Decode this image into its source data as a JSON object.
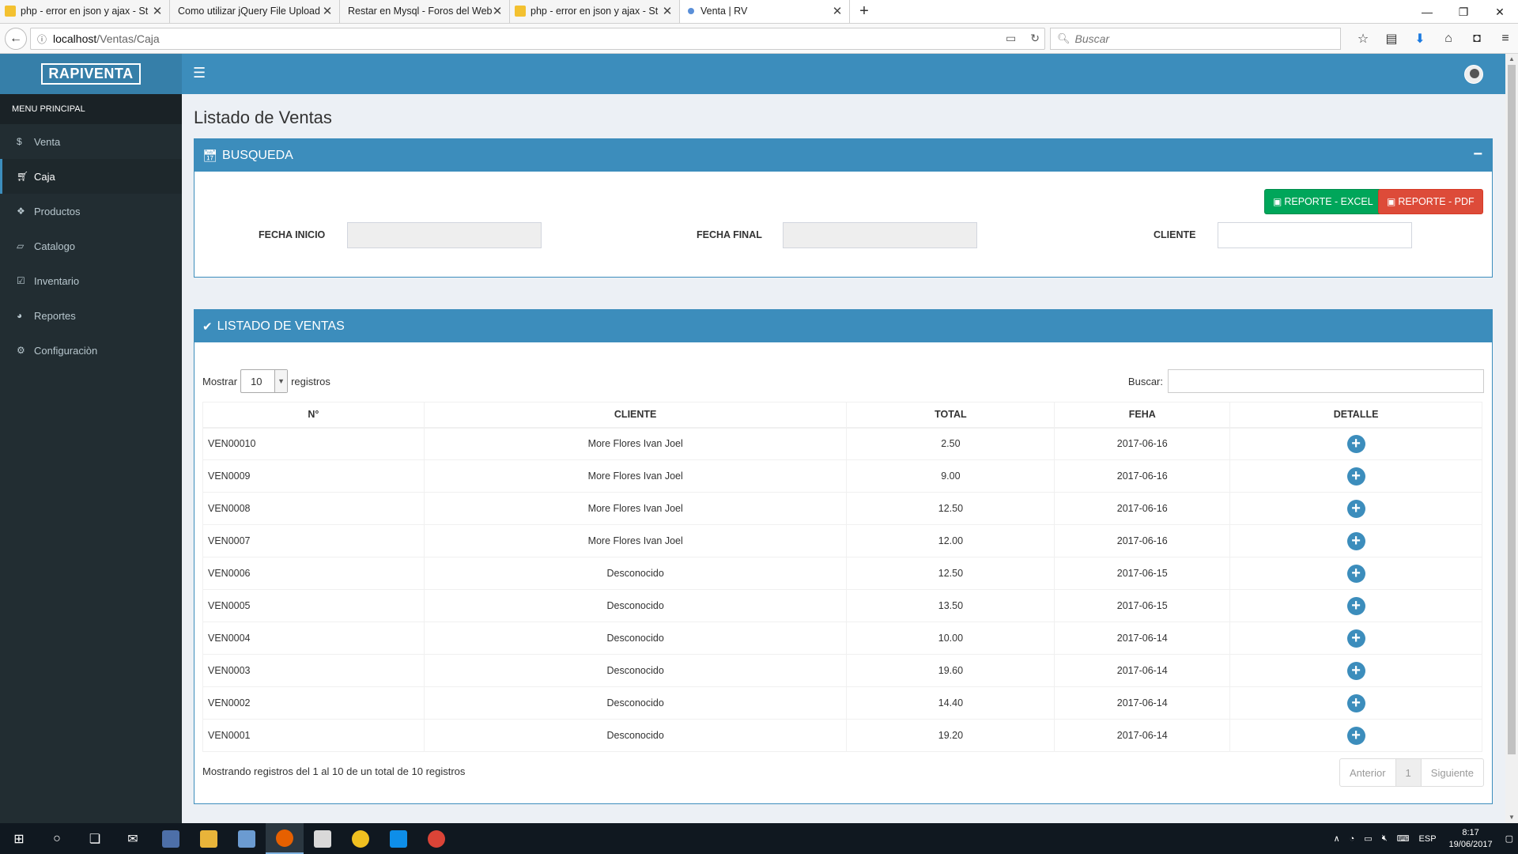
{
  "browser": {
    "tabs": [
      {
        "title": "php - error en json y ajax - St",
        "icon": "stackoverflow-icon"
      },
      {
        "title": "Como utilizar jQuery File Upload",
        "icon": "page-icon"
      },
      {
        "title": "Restar en Mysql - Foros del Web",
        "icon": "page-icon"
      },
      {
        "title": "php - error en json y ajax - St",
        "icon": "stackoverflow-icon"
      },
      {
        "title": "Venta | RV",
        "icon": "page-icon"
      }
    ],
    "url_host": "localhost",
    "url_path": "/Ventas/Caja",
    "search_placeholder": "Buscar"
  },
  "app": {
    "logo": "RAPIVENTA",
    "accent_color": "#3c8dbc"
  },
  "sidebar": {
    "header": "MENU PRINCIPAL",
    "items": [
      {
        "label": "Venta",
        "icon": "dollar-icon"
      },
      {
        "label": "Caja",
        "icon": "cart-icon"
      },
      {
        "label": "Productos",
        "icon": "cubes-icon"
      },
      {
        "label": "Catalogo",
        "icon": "folder-icon"
      },
      {
        "label": "Inventario",
        "icon": "check-square-icon"
      },
      {
        "label": "Reportes",
        "icon": "pie-chart-icon"
      },
      {
        "label": "Configuraciòn",
        "icon": "gear-icon"
      }
    ]
  },
  "main": {
    "title": "Listado de Ventas",
    "search_box": {
      "title": "BUSQUEDA",
      "excel_label": "REPORTE - EXCEL",
      "pdf_label": "REPORTE - PDF",
      "fecha_inicio_label": "FECHA INICIO",
      "fecha_final_label": "FECHA FINAL",
      "cliente_label": "CLIENTE"
    },
    "list_box": {
      "title": "LISTADO DE VENTAS",
      "mostrar_label": "Mostrar",
      "page_size": "10",
      "registros_label": "registros",
      "buscar_label": "Buscar:",
      "columns": [
        "N°",
        "CLIENTE",
        "TOTAL",
        "FEHA",
        "DETALLE"
      ],
      "rows": [
        {
          "num": "VEN00010",
          "cliente": "More Flores Ivan Joel",
          "total": "2.50",
          "fecha": "2017-06-16"
        },
        {
          "num": "VEN0009",
          "cliente": "More Flores Ivan Joel",
          "total": "9.00",
          "fecha": "2017-06-16"
        },
        {
          "num": "VEN0008",
          "cliente": "More Flores Ivan Joel",
          "total": "12.50",
          "fecha": "2017-06-16"
        },
        {
          "num": "VEN0007",
          "cliente": "More Flores Ivan Joel",
          "total": "12.00",
          "fecha": "2017-06-16"
        },
        {
          "num": "VEN0006",
          "cliente": "Desconocido",
          "total": "12.50",
          "fecha": "2017-06-15"
        },
        {
          "num": "VEN0005",
          "cliente": "Desconocido",
          "total": "13.50",
          "fecha": "2017-06-15"
        },
        {
          "num": "VEN0004",
          "cliente": "Desconocido",
          "total": "10.00",
          "fecha": "2017-06-14"
        },
        {
          "num": "VEN0003",
          "cliente": "Desconocido",
          "total": "19.60",
          "fecha": "2017-06-14"
        },
        {
          "num": "VEN0002",
          "cliente": "Desconocido",
          "total": "14.40",
          "fecha": "2017-06-14"
        },
        {
          "num": "VEN0001",
          "cliente": "Desconocido",
          "total": "19.20",
          "fecha": "2017-06-14"
        }
      ],
      "info": "Mostrando registros del 1 al 10 de un total de 10 registros",
      "prev_label": "Anterior",
      "current_page": "1",
      "next_label": "Siguiente"
    }
  },
  "taskbar": {
    "language": "ESP",
    "time": "8:17",
    "date": "19/06/2017"
  }
}
